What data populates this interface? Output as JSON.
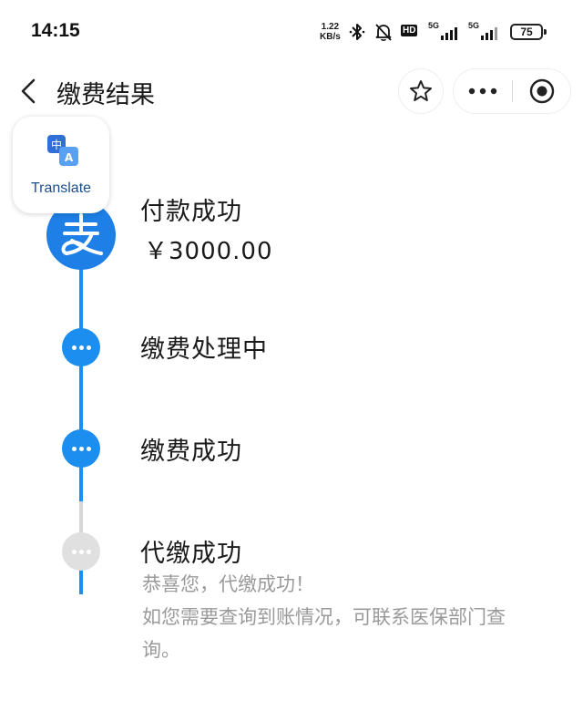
{
  "status_bar": {
    "time": "14:15",
    "speed_value": "1.22",
    "speed_unit": "KB/s",
    "hd_label": "HD",
    "sim1_label": "5G",
    "sim2_label": "5G",
    "battery": "75"
  },
  "nav": {
    "title": "缴费结果"
  },
  "translate_widget": {
    "label": "Translate",
    "icon_text_cn": "中",
    "icon_text_en": "A"
  },
  "timeline": {
    "steps": [
      {
        "title": "付款成功",
        "amount": "￥3000.00",
        "state": "done",
        "icon": "alipay-icon"
      },
      {
        "title": "缴费处理中",
        "state": "done",
        "icon": "more-dots-icon"
      },
      {
        "title": "缴费成功",
        "state": "done",
        "icon": "more-dots-icon"
      },
      {
        "title": "代缴成功",
        "state": "pending",
        "icon": "more-dots-icon",
        "desc_line1": "恭喜您，代缴成功！",
        "desc_line2": "如您需要查询到账情况，可联系医保部门查",
        "desc_line3": "询。"
      }
    ]
  },
  "colors": {
    "accent_blue": "#1c8ef0",
    "alipay_blue": "#1e7fe6",
    "pending_gray": "#e0e0e0",
    "desc_text": "#9a9a9a"
  }
}
